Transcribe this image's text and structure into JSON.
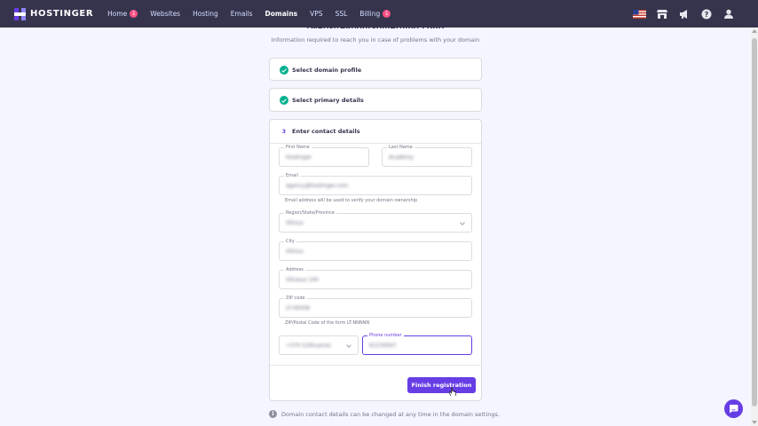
{
  "header": {
    "logo_text": "HOSTINGER",
    "nav": [
      {
        "label": "Home",
        "badge": "1"
      },
      {
        "label": "Websites"
      },
      {
        "label": "Hosting"
      },
      {
        "label": "Emails"
      },
      {
        "label": "Domains",
        "active": true
      },
      {
        "label": "VPS"
      },
      {
        "label": "SSL"
      },
      {
        "label": "Billing",
        "badge": "1"
      }
    ],
    "icons": [
      "us-flag-icon",
      "store-icon",
      "megaphone-icon",
      "help-icon",
      "user-icon"
    ]
  },
  "page": {
    "title": "(websiteaboutsomething.com)",
    "subtitle": "Information required to reach you in case of problems with your domain"
  },
  "steps": [
    {
      "label": "Select domain profile",
      "status": "complete"
    },
    {
      "label": "Select primary details",
      "status": "complete"
    },
    {
      "number": "3",
      "label": "Enter contact details",
      "status": "active"
    }
  ],
  "form": {
    "first_name": {
      "label": "First Name",
      "value": "Hostinger"
    },
    "last_name": {
      "label": "Last Name",
      "value": "Academy"
    },
    "email": {
      "label": "Email",
      "value": "agency@hostinger.com",
      "hint": "Email address will be used to verify your domain ownership"
    },
    "region": {
      "label": "Region/State/Province",
      "value": "Vilnius"
    },
    "city": {
      "label": "City",
      "value": "Vilnius"
    },
    "address": {
      "label": "Address",
      "value": "Vilniaus 100"
    },
    "zip": {
      "label": "ZIP code",
      "value": "LT-09308",
      "hint": "ZIP/Postal Code of the form LT-NNNNN"
    },
    "country_code": {
      "value": "+370 (Lithuania)"
    },
    "phone": {
      "label": "Phone number",
      "value": "61234567"
    },
    "submit_label": "Finish registration"
  },
  "footer_note": "Domain contact details can be changed at any time in the domain settings.",
  "colors": {
    "primary": "#673de6",
    "topbar": "#36344d",
    "success": "#00b090",
    "badge": "#fc5185"
  }
}
